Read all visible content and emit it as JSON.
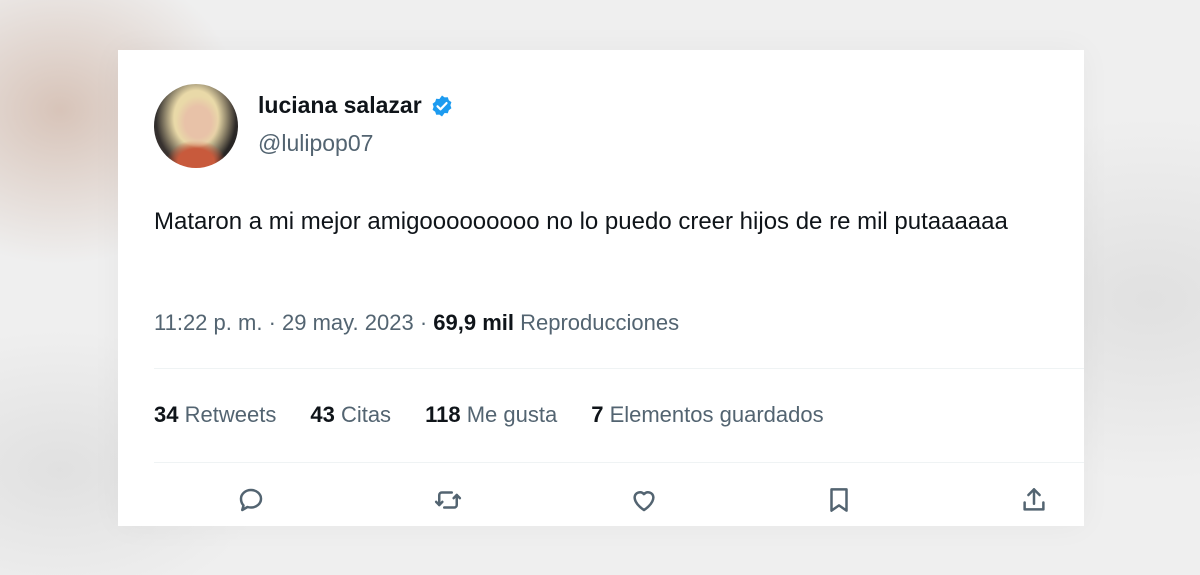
{
  "tweet": {
    "author": {
      "display_name": "luciana salazar",
      "handle": "@lulipop07",
      "verified": true,
      "verified_color": "#1d9bf0"
    },
    "text": "Mataron a mi mejor amigooooooooo no lo puedo creer hijos de re mil putaaaaaa",
    "meta": {
      "time": "11:22 p. m.",
      "separator": "·",
      "date": "29 may. 2023",
      "views_count": "69,9 mil",
      "views_label": "Reproducciones"
    },
    "stats": [
      {
        "count": "34",
        "label": "Retweets"
      },
      {
        "count": "43",
        "label": "Citas"
      },
      {
        "count": "118",
        "label": "Me gusta"
      },
      {
        "count": "7",
        "label": "Elementos guardados"
      }
    ],
    "actions": [
      {
        "icon": "reply-icon"
      },
      {
        "icon": "retweet-icon"
      },
      {
        "icon": "like-icon"
      },
      {
        "icon": "bookmark-icon"
      },
      {
        "icon": "share-icon"
      }
    ]
  },
  "colors": {
    "text_primary": "#0f1419",
    "text_secondary": "#536471",
    "divider": "#eff3f4"
  }
}
